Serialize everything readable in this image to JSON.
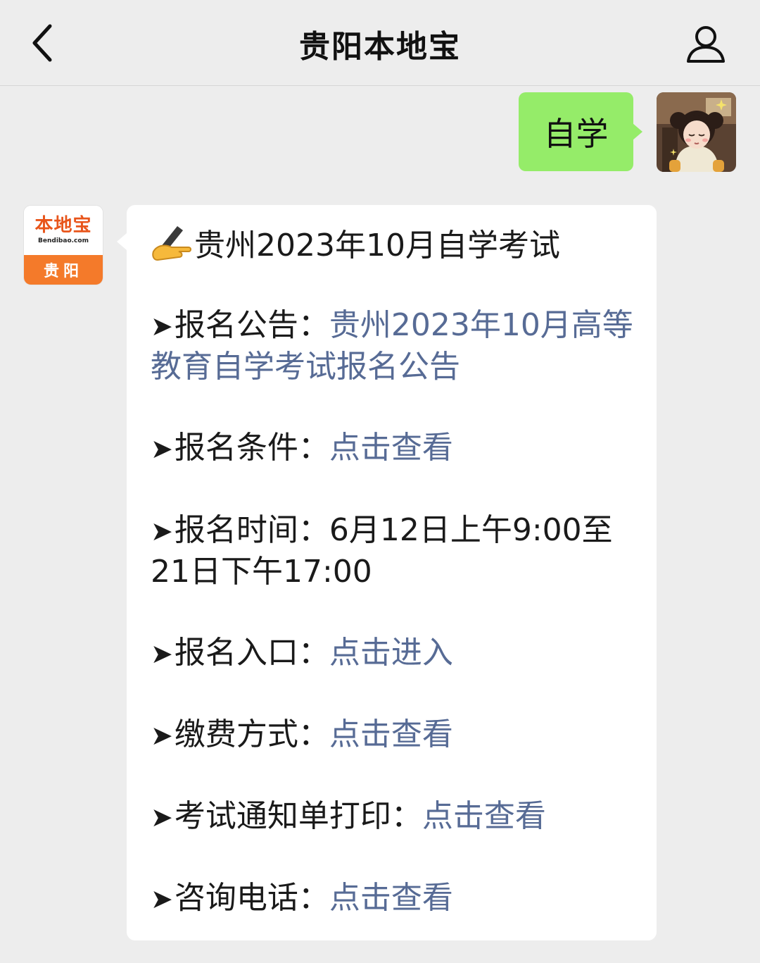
{
  "header": {
    "title": "贵阳本地宝",
    "back_icon": "chevron-left-icon",
    "profile_icon": "person-icon"
  },
  "outgoing": {
    "text": "自学",
    "bubble_color": "#95ec69"
  },
  "bot": {
    "avatar": {
      "brand": "本地宝",
      "url": "Bendibao.com",
      "city": "贵阳"
    }
  },
  "message": {
    "title_emoji": "writing-hand-icon",
    "title": "贵州2023年10月自学考试",
    "arrow": "➤",
    "items": [
      {
        "label": "报名公告：",
        "link": "贵州2023年10月高等教育自学考试报名公告"
      },
      {
        "label": "报名条件：",
        "link": "点击查看"
      },
      {
        "label": "报名时间：6月12日上午9:00至21日下午17:00",
        "link": ""
      },
      {
        "label": "报名入口：",
        "link": "点击进入"
      },
      {
        "label": "缴费方式：",
        "link": "点击查看"
      },
      {
        "label": "考试通知单打印：",
        "link": "点击查看"
      },
      {
        "label": "咨询电话：",
        "link": "点击查看"
      }
    ],
    "link_color": "#576b95"
  }
}
